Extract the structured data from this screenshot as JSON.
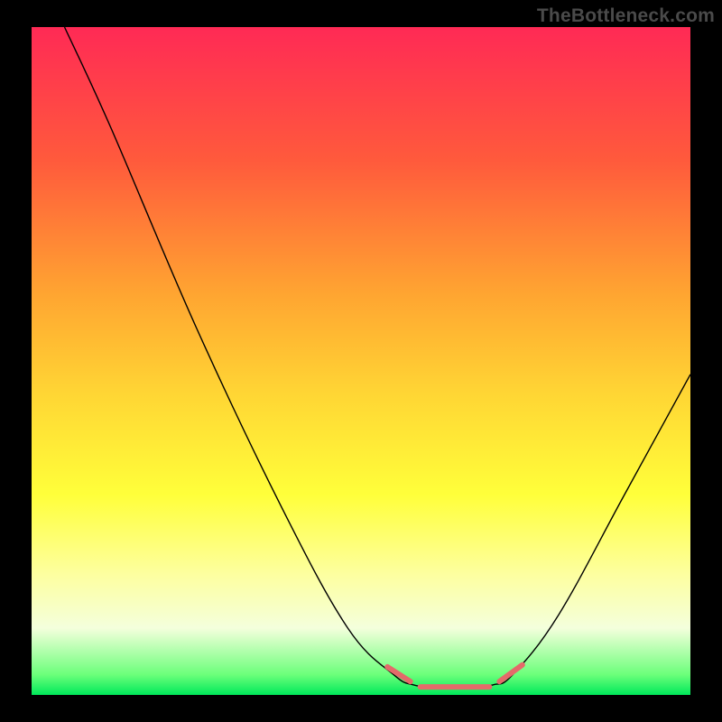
{
  "watermark": "TheBottleneck.com",
  "chart_data": {
    "type": "line",
    "title": "",
    "xlabel": "",
    "ylabel": "",
    "xlim": [
      0,
      100
    ],
    "ylim": [
      0,
      100
    ],
    "grid": false,
    "legend": false,
    "background_gradient": {
      "stops": [
        {
          "offset": 0.0,
          "color": "#ff2a55"
        },
        {
          "offset": 0.2,
          "color": "#ff5a3c"
        },
        {
          "offset": 0.4,
          "color": "#ffa531"
        },
        {
          "offset": 0.55,
          "color": "#ffd634"
        },
        {
          "offset": 0.7,
          "color": "#ffff3a"
        },
        {
          "offset": 0.82,
          "color": "#fdffa0"
        },
        {
          "offset": 0.9,
          "color": "#f4ffdc"
        },
        {
          "offset": 0.97,
          "color": "#6bff7a"
        },
        {
          "offset": 1.0,
          "color": "#00e85a"
        }
      ]
    },
    "series": [
      {
        "name": "curve",
        "color": "#000000",
        "stroke_width": 1.4,
        "points": [
          {
            "x": 5,
            "y": 100
          },
          {
            "x": 12,
            "y": 85
          },
          {
            "x": 25,
            "y": 55
          },
          {
            "x": 38,
            "y": 28
          },
          {
            "x": 48,
            "y": 10
          },
          {
            "x": 55,
            "y": 3
          },
          {
            "x": 58,
            "y": 1.5
          },
          {
            "x": 62,
            "y": 1
          },
          {
            "x": 66,
            "y": 1
          },
          {
            "x": 70,
            "y": 1.5
          },
          {
            "x": 73,
            "y": 3
          },
          {
            "x": 80,
            "y": 12
          },
          {
            "x": 90,
            "y": 30
          },
          {
            "x": 100,
            "y": 48
          }
        ]
      },
      {
        "name": "highlight-left",
        "color": "#e46a6a",
        "stroke_width": 6,
        "linecap": "round",
        "points": [
          {
            "x": 54,
            "y": 4.2
          },
          {
            "x": 57.5,
            "y": 2
          }
        ]
      },
      {
        "name": "highlight-bottom",
        "color": "#e46a6a",
        "stroke_width": 6,
        "linecap": "round",
        "points": [
          {
            "x": 59,
            "y": 1.2
          },
          {
            "x": 69.5,
            "y": 1.2
          }
        ]
      },
      {
        "name": "highlight-right",
        "color": "#e46a6a",
        "stroke_width": 6,
        "linecap": "round",
        "points": [
          {
            "x": 71,
            "y": 2
          },
          {
            "x": 74.5,
            "y": 4.5
          }
        ]
      }
    ]
  }
}
